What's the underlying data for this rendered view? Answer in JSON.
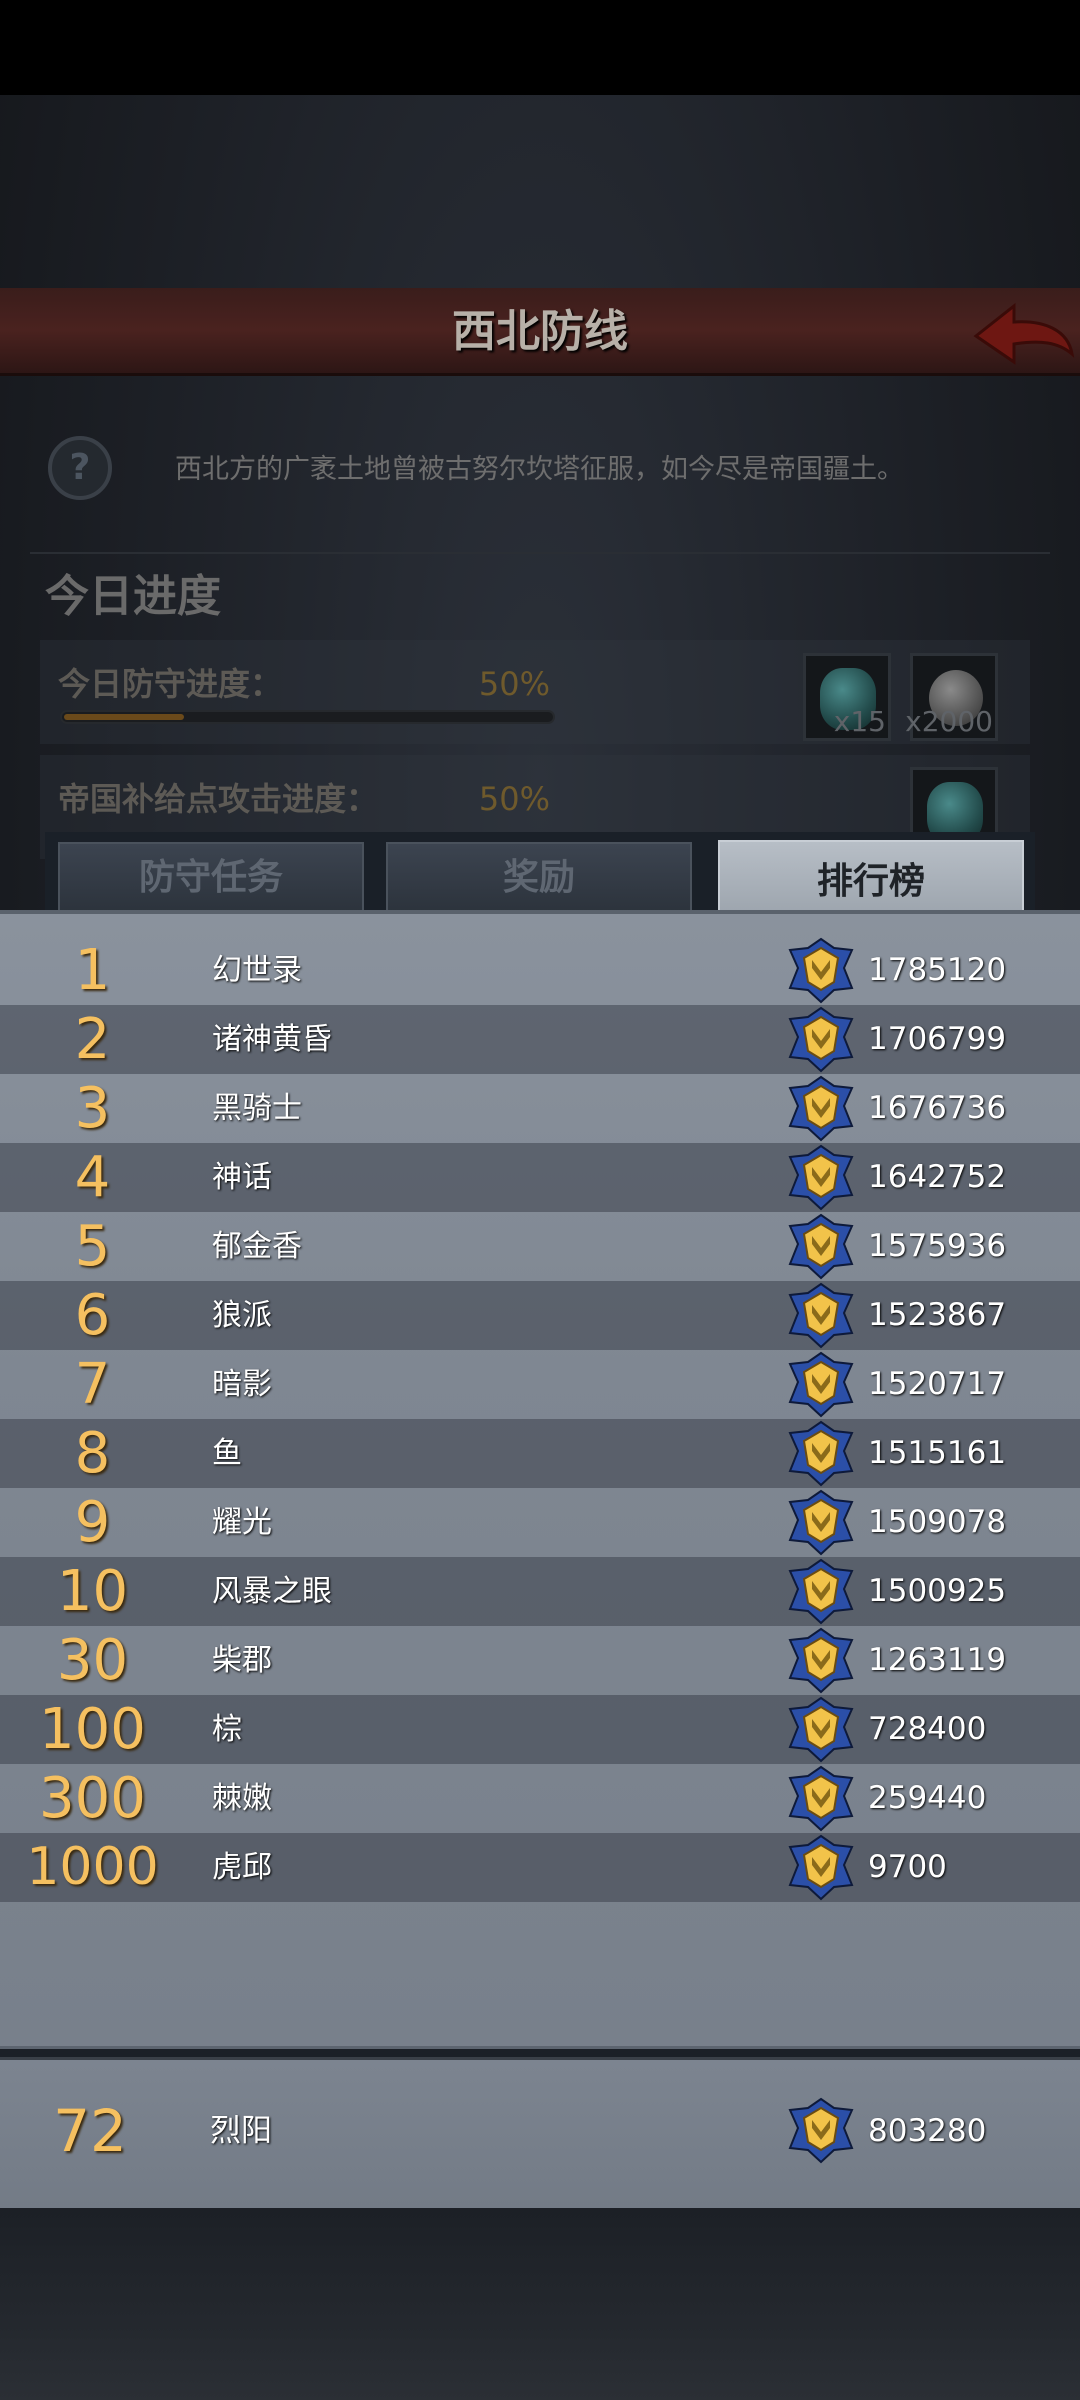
{
  "header": {
    "title": "西北防线"
  },
  "info": {
    "help_symbol": "?",
    "description": "西北方的广袤土地曾被古努尔坎塔征服，如今尽是帝国疆土。"
  },
  "progress": {
    "heading": "今日进度",
    "rows": [
      {
        "label": "今日防守进度：",
        "value": "50%",
        "fraction": 0.5,
        "rewards": [
          {
            "icon": "gem-icon",
            "count": "x15"
          },
          {
            "icon": "silver-coin-icon",
            "count": "x2000"
          }
        ]
      },
      {
        "label": "帝国补给点攻击进度：",
        "value": "50%",
        "fraction": 0.5,
        "rewards": [
          {
            "icon": "gem-icon",
            "count": ""
          }
        ]
      }
    ]
  },
  "tabs": {
    "defense": "防守任务",
    "rewards": "奖励",
    "ranking": "排行榜",
    "active": "ranking"
  },
  "ranking": {
    "rows": [
      {
        "rank": "1",
        "name": "幻世录",
        "score": "1785120"
      },
      {
        "rank": "2",
        "name": "诸神黄昏",
        "score": "1706799"
      },
      {
        "rank": "3",
        "name": "黑骑士",
        "score": "1676736"
      },
      {
        "rank": "4",
        "name": "神话",
        "score": "1642752"
      },
      {
        "rank": "5",
        "name": "郁金香",
        "score": "1575936"
      },
      {
        "rank": "6",
        "name": "狼派",
        "score": "1523867"
      },
      {
        "rank": "7",
        "name": "暗影",
        "score": "1520717"
      },
      {
        "rank": "8",
        "name": "鱼",
        "score": "1515161"
      },
      {
        "rank": "9",
        "name": "耀光",
        "score": "1509078"
      },
      {
        "rank": "10",
        "name": "风暴之眼",
        "score": "1500925"
      },
      {
        "rank": "30",
        "name": "柴郡",
        "score": "1263119"
      },
      {
        "rank": "100",
        "name": "棕",
        "score": "728400"
      },
      {
        "rank": "300",
        "name": "棘嫩",
        "score": "259440"
      },
      {
        "rank": "1000",
        "name": "虎邱",
        "score": "9700"
      }
    ],
    "mine": {
      "rank": "72",
      "name": "烈阳",
      "score": "803280"
    }
  },
  "colors": {
    "rank_gold": "#f5c060",
    "badge_blue": "#2b4fa8",
    "badge_gold": "#f2c34a"
  }
}
